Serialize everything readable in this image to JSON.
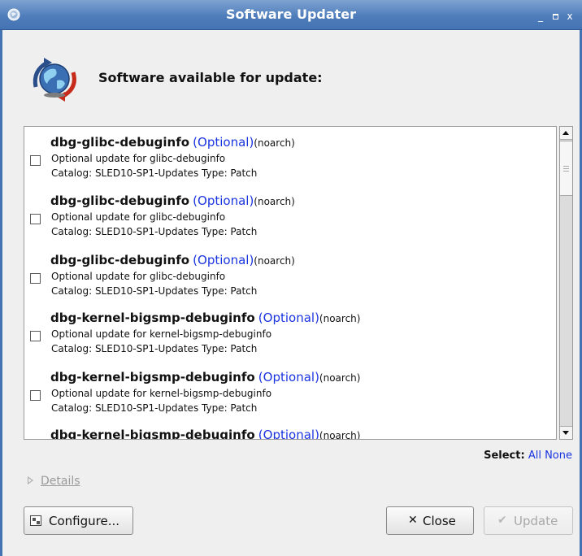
{
  "window": {
    "title": "Software Updater",
    "minimize_glyph": "_",
    "close_glyph": "x"
  },
  "header": {
    "label": "Software available for update:",
    "icon": "globe-update-icon"
  },
  "updates": [
    {
      "name": "dbg-glibc-debuginfo",
      "optional": "(Optional)",
      "arch": "(noarch)",
      "description": "Optional update for glibc-debuginfo",
      "catalog": "Catalog: SLED10-SP1-Updates Type: Patch"
    },
    {
      "name": "dbg-glibc-debuginfo",
      "optional": "(Optional)",
      "arch": "(noarch)",
      "description": "Optional update for glibc-debuginfo",
      "catalog": "Catalog: SLED10-SP1-Updates Type: Patch"
    },
    {
      "name": "dbg-glibc-debuginfo",
      "optional": "(Optional)",
      "arch": "(noarch)",
      "description": "Optional update for glibc-debuginfo",
      "catalog": "Catalog: SLED10-SP1-Updates Type: Patch"
    },
    {
      "name": "dbg-kernel-bigsmp-debuginfo",
      "optional": "(Optional)",
      "arch": "(noarch)",
      "description": "Optional update for kernel-bigsmp-debuginfo",
      "catalog": "Catalog: SLED10-SP1-Updates Type: Patch"
    },
    {
      "name": "dbg-kernel-bigsmp-debuginfo",
      "optional": "(Optional)",
      "arch": "(noarch)",
      "description": "Optional update for kernel-bigsmp-debuginfo",
      "catalog": "Catalog: SLED10-SP1-Updates Type: Patch"
    },
    {
      "name": "dbg-kernel-bigsmp-debuginfo",
      "optional": "(Optional)",
      "arch": "(noarch)",
      "description": "",
      "catalog": ""
    }
  ],
  "select": {
    "label": "Select:",
    "all": "All",
    "none": "None"
  },
  "details": {
    "label": "Details"
  },
  "buttons": {
    "configure": "Configure...",
    "close": "Close",
    "update": "Update"
  },
  "colors": {
    "titlebar": "#4f7dbb",
    "link": "#1a34e0",
    "disabled": "#a8a8a8"
  }
}
